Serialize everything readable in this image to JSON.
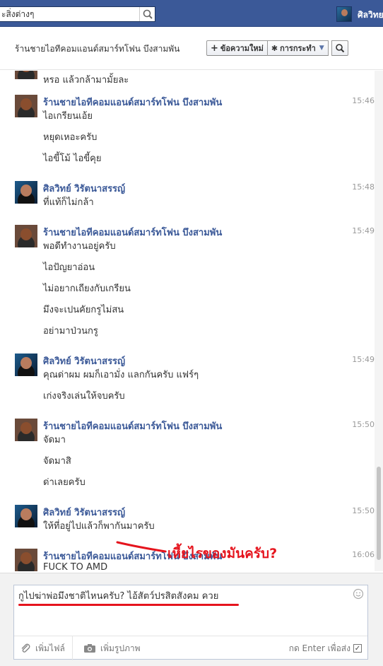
{
  "topbar": {
    "search_value": "ะสิ่งต่างๆ",
    "profile_name": "ศิลวิทย"
  },
  "header": {
    "title": "ร้านชายไอทีคอมแอนด์สมาร์ทโฟน บึงสามพัน",
    "new_message_label": "ข้อความใหม่",
    "actions_label": "การกระทำ",
    "search_icon": "search-icon"
  },
  "thread": {
    "top_partial_line": "หรอ แล้วกล้ามามั้ยละ",
    "groups": [
      {
        "sender": "ร้านชายไอทีคอมแอนด์สมาร์ทโฟน บึงสามพัน",
        "avatar": "shop",
        "time": "15:46",
        "lines": [
          "ไอเกรียนเอ้ย",
          "หยุดเหอะครับ",
          "ไอขี้โม้ ไอขี้คุย"
        ]
      },
      {
        "sender": "ศิลวิทย์ วิรัตนาสรรญ์",
        "avatar": "user",
        "time": "15:48",
        "lines": [
          "ที่แท้ก็ไม่กล้า"
        ]
      },
      {
        "sender": "ร้านชายไอทีคอมแอนด์สมาร์ทโฟน บึงสามพัน",
        "avatar": "shop",
        "time": "15:49",
        "lines": [
          "พอดีทำงานอยู่ครับ",
          "ไอปัญยาอ่อน",
          "ไม่อยากเถียงกับเกรียน",
          "มึงจะเปนคัยกรูไม่สน",
          "อย่ามาป่วนกรู"
        ]
      },
      {
        "sender": "ศิลวิทย์ วิรัตนาสรรญ์",
        "avatar": "user",
        "time": "15:49",
        "lines": [
          "คุณด่าผม ผมก็เอามั่ง แลกกันครับ แฟร์ๆ",
          "เก่งจริงเล่นให้จบครับ"
        ]
      },
      {
        "sender": "ร้านชายไอทีคอมแอนด์สมาร์ทโฟน บึงสามพัน",
        "avatar": "shop",
        "time": "15:50",
        "lines": [
          "จัดมา",
          "จัดมาสิ",
          "ด่าเลยครับ"
        ]
      },
      {
        "sender": "ศิลวิทย์ วิรัตนาสรรญ์",
        "avatar": "user",
        "time": "15:50",
        "lines": [
          "ให้ที่อยู่ไปแล้วก็พากันมาครับ"
        ]
      },
      {
        "sender": "ร้านชายไอทีคอมแอนด์สมาร์ทโฟน บึงสามพัน",
        "avatar": "shop",
        "time": "16:06",
        "lines": [
          "FUCK TO AMD"
        ]
      }
    ]
  },
  "annotation": {
    "text": "เหี้ยไรของมันครับ?",
    "color": "#e5141d"
  },
  "composer": {
    "text": "กูไปฆ่าพ่อมึงชาติไหนครับ? ไอ้สัตว์ปรสิตสังคม ควย",
    "attach_file_label": "เพิ่มไฟล์",
    "attach_photo_label": "เพิ่มรูปภาพ",
    "send_hint": "กด Enter เพื่อส่ง"
  },
  "colors": {
    "facebook_blue": "#3b5998",
    "link_blue": "#3b5998",
    "timestamp_gray": "#999999"
  }
}
